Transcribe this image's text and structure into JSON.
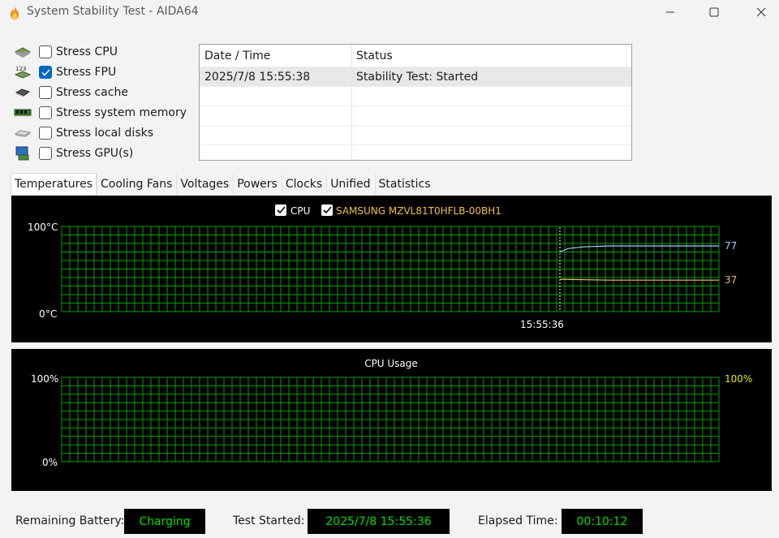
{
  "window": {
    "title": "System Stability Test - AIDA64"
  },
  "stress_options": [
    {
      "label": "Stress CPU",
      "checked": false,
      "icon": "cpu-chip-icon"
    },
    {
      "label": "Stress FPU",
      "checked": true,
      "icon": "fpu-123-icon"
    },
    {
      "label": "Stress cache",
      "checked": false,
      "icon": "cache-chip-icon"
    },
    {
      "label": "Stress system memory",
      "checked": false,
      "icon": "memory-module-icon"
    },
    {
      "label": "Stress local disks",
      "checked": false,
      "icon": "disk-drive-icon"
    },
    {
      "label": "Stress GPU(s)",
      "checked": false,
      "icon": "gpu-monitor-icon"
    }
  ],
  "log": {
    "columns": [
      "Date / Time",
      "Status"
    ],
    "rows": [
      {
        "datetime": "2025/7/8 15:55:38",
        "status": "Stability Test: Started"
      }
    ]
  },
  "tabs": [
    "Temperatures",
    "Cooling Fans",
    "Voltages",
    "Powers",
    "Clocks",
    "Unified",
    "Statistics"
  ],
  "active_tab": "Temperatures",
  "chart_data": [
    {
      "type": "line",
      "legend": [
        {
          "name": "CPU",
          "checked": true,
          "color": "#ffffff"
        },
        {
          "name": "SAMSUNG MZVL81T0HFLB-00BH1",
          "checked": true,
          "color": "#f0c040"
        }
      ],
      "y_max_label": "100",
      "y_min_label": "0",
      "y_unit": "°C",
      "ylim": [
        0,
        100
      ],
      "marker_time": "15:55:36",
      "series": [
        {
          "name": "CPU",
          "color": "#b8c8ff",
          "current": 77,
          "current_label": "77",
          "points": [
            [
              0.0,
              70
            ],
            [
              0.05,
              74
            ],
            [
              0.15,
              76
            ],
            [
              0.3,
              77
            ],
            [
              1.0,
              77
            ]
          ]
        },
        {
          "name": "SAMSUNG MZVL81T0HFLB-00BH1",
          "color": "#e8c070",
          "current": 37,
          "current_label": "37",
          "points": [
            [
              0.0,
              38
            ],
            [
              0.3,
              37
            ],
            [
              1.0,
              37
            ]
          ]
        }
      ],
      "grid": true,
      "grid_color": "#00a000"
    },
    {
      "type": "line",
      "title": "CPU Usage",
      "y_max_label": "100%",
      "y_min_label": "0%",
      "ylim": [
        0,
        100
      ],
      "current_label": "100%",
      "grid": true,
      "grid_color": "#00a000"
    }
  ],
  "status_bar": {
    "battery_label": "Remaining Battery:",
    "battery_value": "Charging",
    "started_label": "Test Started:",
    "started_value": "2025/7/8 15:55:36",
    "elapsed_label": "Elapsed Time:",
    "elapsed_value": "00:10:12"
  },
  "colors": {
    "accent": "#0067c0",
    "status_text": "#00e000",
    "cpu_line": "#b8c8ff",
    "disk_line": "#e8c070",
    "usage_label": "#e6e600"
  }
}
